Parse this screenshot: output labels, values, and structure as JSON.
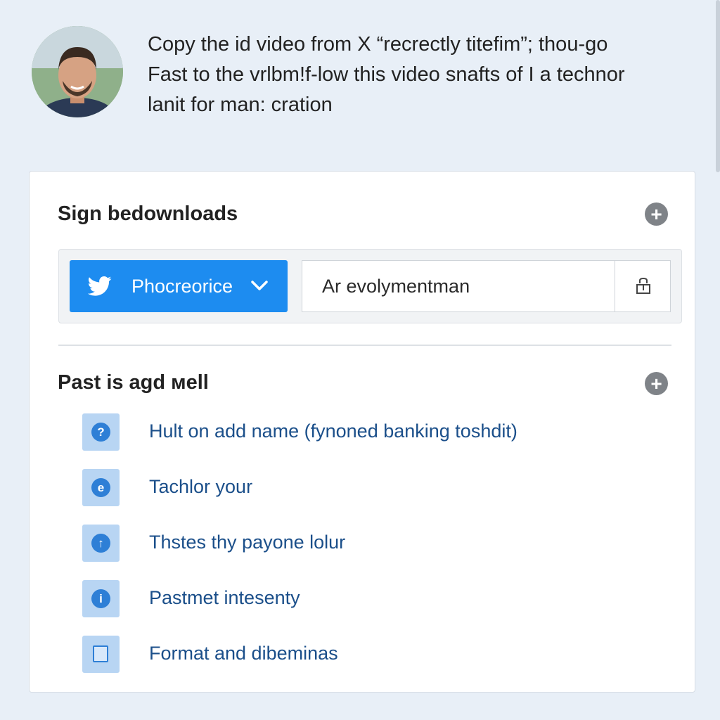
{
  "header": {
    "message_lines": [
      "Copy the id video from X “recrectly titefim”; thou-go",
      "Fast to the vrlbm!f-low this video snafts of I a technor",
      "lanit for man: cration"
    ]
  },
  "downloads": {
    "title": "Sign bedownloads",
    "add_label": "+",
    "platform_label": "Phocreorice",
    "url_value": "Ar evolymentman"
  },
  "paste": {
    "title": "Past is agd мell",
    "add_label": "+",
    "items": [
      {
        "label": "Hult on add name (fynoned banking toshdit)",
        "icon": "help-icon",
        "glyph": "?"
      },
      {
        "label": "Tachlor your",
        "icon": "user-icon",
        "glyph": "e"
      },
      {
        "label": "Thstes thy payone lolur",
        "icon": "upload-icon",
        "glyph": "↑"
      },
      {
        "label": "Pastmet intesenty",
        "icon": "info-icon",
        "glyph": "i"
      },
      {
        "label": "Format and dibeminas",
        "icon": "document-icon",
        "glyph": ""
      }
    ]
  },
  "colors": {
    "accent": "#1d8cf0",
    "background": "#e8eff7",
    "link_text": "#1b4f8a",
    "icon_tile": "#b8d5f3"
  }
}
